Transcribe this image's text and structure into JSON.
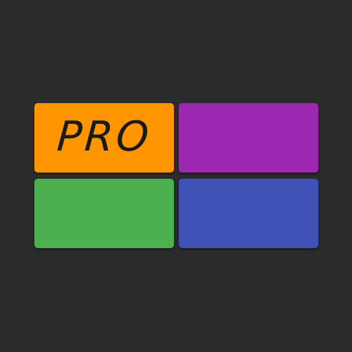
{
  "badge": {
    "label": "PRO"
  },
  "colors": {
    "background": "#2b2b2b",
    "tile_orange": "#ff9500",
    "tile_purple": "#9c27b0",
    "tile_green": "#4caf50",
    "tile_blue": "#3f51b5",
    "label_text": "#1a1a1a"
  }
}
